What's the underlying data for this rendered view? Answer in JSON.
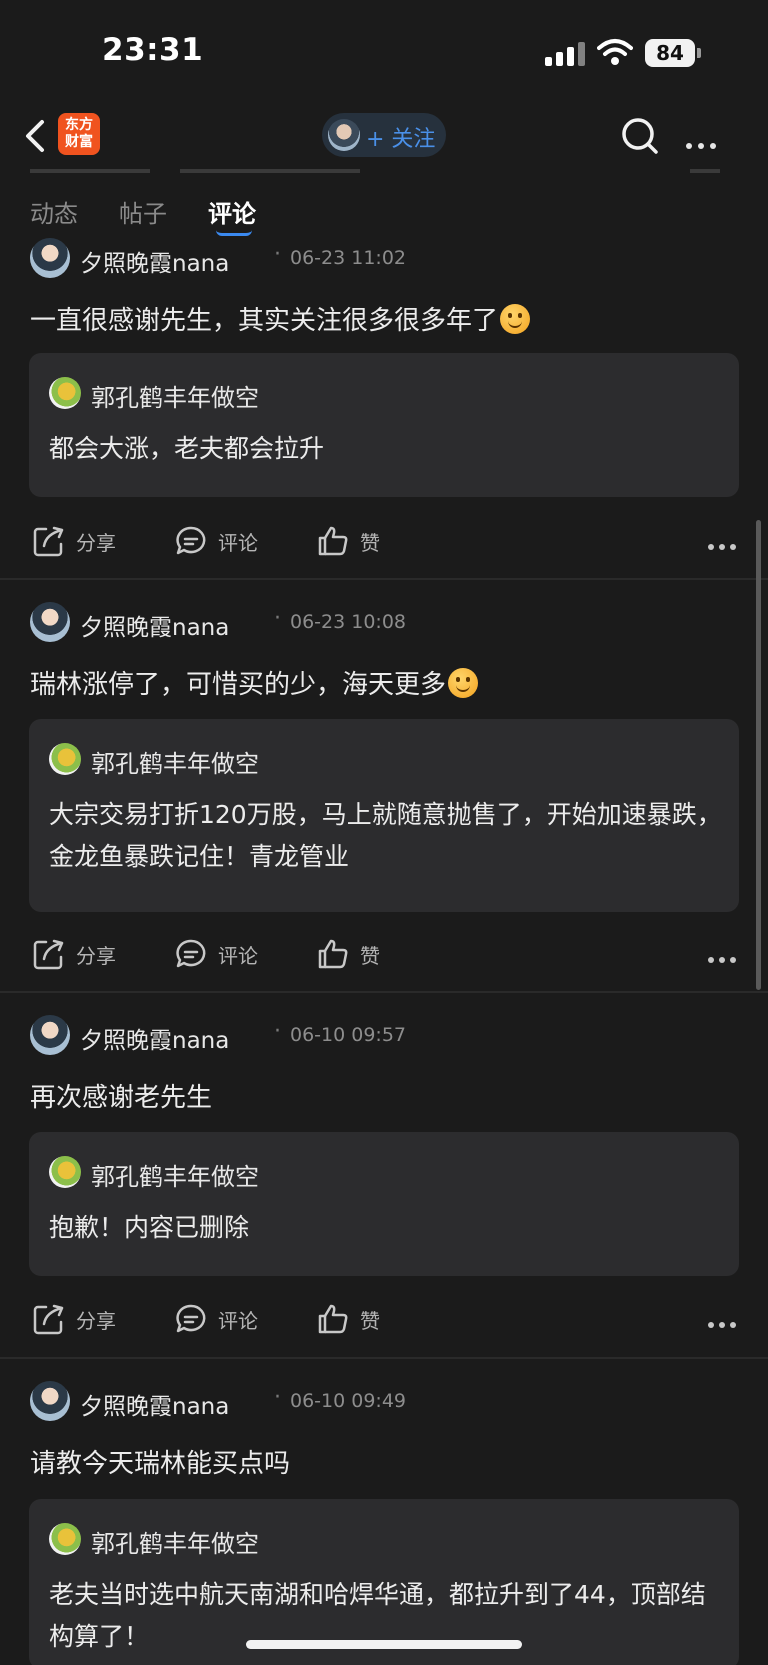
{
  "status_bar": {
    "time": "23:31",
    "battery": "84"
  },
  "nav": {
    "logo_line1": "东方",
    "logo_line2": "财富",
    "follow_label": "+ 关注"
  },
  "tabs": [
    "动态",
    "帖子",
    "评论"
  ],
  "active_tab": "评论",
  "actions": {
    "share": "分享",
    "comment": "评论",
    "like": "赞"
  },
  "comments": [
    {
      "author": "夕照晚霞nana",
      "time": "06-23 11:02",
      "text": "一直很感谢先生，其实关注很多很多年了",
      "has_emoji": true,
      "quote": {
        "author": "郭孔鹤丰年做空",
        "text": "都会大涨，老夫都会拉升"
      }
    },
    {
      "author": "夕照晚霞nana",
      "time": "06-23 10:08",
      "text": "瑞林涨停了，可惜买的少，海天更多",
      "has_emoji": true,
      "quote": {
        "author": "郭孔鹤丰年做空",
        "text": "大宗交易打折120万股，马上就随意抛售了，开始加速暴跌，金龙鱼暴跌记住！青龙管业"
      }
    },
    {
      "author": "夕照晚霞nana",
      "time": "06-10 09:57",
      "text": "再次感谢老先生",
      "has_emoji": false,
      "quote": {
        "author": "郭孔鹤丰年做空",
        "text": "抱歉！内容已删除"
      }
    },
    {
      "author": "夕照晚霞nana",
      "time": "06-10 09:49",
      "text": "请教今天瑞林能买点吗",
      "has_emoji": false,
      "quote": {
        "author": "郭孔鹤丰年做空",
        "text": "老夫当时选中航天南湖和哈焊华通，都拉升到了44，顶部结构算了！"
      }
    }
  ],
  "colors": {
    "background": "#1b1b1b",
    "card": "#2c2c2e",
    "accent": "#3b8af0",
    "logo": "#f0531f"
  }
}
